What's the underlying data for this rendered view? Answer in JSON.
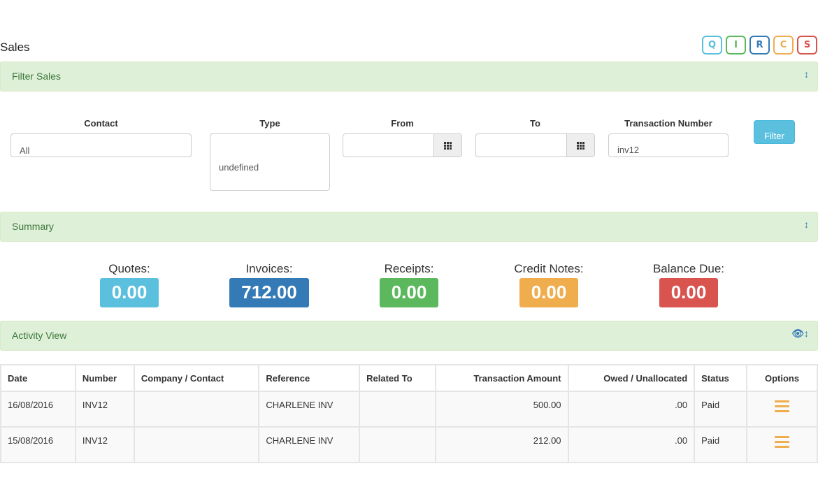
{
  "page_title": "Sales",
  "quick_buttons": [
    {
      "label": "Q",
      "color": "#5bc0de"
    },
    {
      "label": "I",
      "color": "#5cb85c"
    },
    {
      "label": "R",
      "color": "#337ab7"
    },
    {
      "label": "C",
      "color": "#f0ad4e"
    },
    {
      "label": "S",
      "color": "#d9534f"
    }
  ],
  "filter_panel": {
    "title": "Filter Sales",
    "contact_label": "Contact",
    "contact_value": "All",
    "type_label": "Type",
    "type_value": "undefined",
    "from_label": "From",
    "from_value": "",
    "to_label": "To",
    "to_value": "",
    "txn_label": "Transaction Number",
    "txn_value": "inv12",
    "filter_button": "Filter"
  },
  "summary_panel": {
    "title": "Summary",
    "quotes_label": "Quotes:",
    "quotes_value": "0.00",
    "invoices_label": "Invoices:",
    "invoices_value": "712.00",
    "receipts_label": "Receipts:",
    "receipts_value": "0.00",
    "credit_label": "Credit Notes:",
    "credit_value": "0.00",
    "balance_label": "Balance Due:",
    "balance_value": "0.00"
  },
  "activity_panel": {
    "title": "Activity View",
    "columns": {
      "date": "Date",
      "number": "Number",
      "company": "Company / Contact",
      "reference": "Reference",
      "related": "Related To",
      "amount": "Transaction Amount",
      "owed": "Owed / Unallocated",
      "status": "Status",
      "options": "Options"
    },
    "rows": [
      {
        "date": "16/08/2016",
        "number": "INV12",
        "company": "",
        "reference": "CHARLENE INV",
        "related": "",
        "amount": "500.00",
        "owed": ".00",
        "status": "Paid"
      },
      {
        "date": "15/08/2016",
        "number": "INV12",
        "company": "",
        "reference": "CHARLENE INV",
        "related": "",
        "amount": "212.00",
        "owed": ".00",
        "status": "Paid"
      }
    ]
  },
  "colors": {
    "panel_bg": "#dff0d8",
    "panel_text": "#3c763d",
    "info": "#5bc0de",
    "primary": "#337ab7",
    "success": "#5cb85c",
    "warning": "#f0ad4e",
    "danger": "#d9534f"
  }
}
